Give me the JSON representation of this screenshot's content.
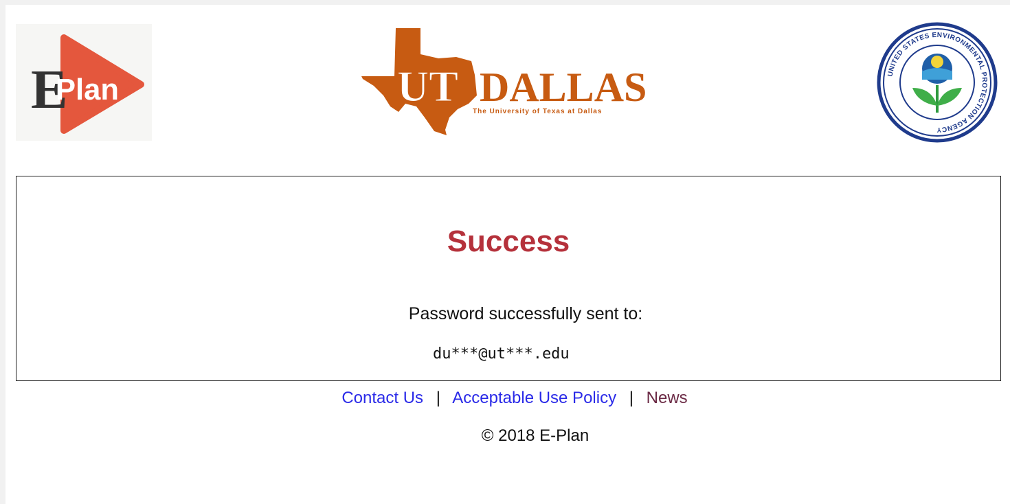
{
  "header": {
    "eplan_logo": {
      "icon": "eplan-logo-icon",
      "text_e": "E",
      "text_plan": "Plan",
      "accent_color": "#e4573d"
    },
    "utd_logo": {
      "icon": "ut-dallas-logo-icon",
      "text_ut": "UT",
      "text_dallas": "DALLAS",
      "subtitle": "The University of Texas at Dallas",
      "color": "#c75b12"
    },
    "epa_logo": {
      "icon": "epa-seal-icon",
      "ring_text": "UNITED STATES ENVIRONMENTAL PROTECTION AGENCY",
      "color": "#1f3b8c"
    }
  },
  "main": {
    "title": "Success",
    "title_color": "#b5313b",
    "message": "Password successfully sent to:",
    "email": "du***@ut***.edu"
  },
  "footer": {
    "links": [
      {
        "label": "Contact Us",
        "color": "#2a2ae8"
      },
      {
        "label": "Acceptable Use Policy",
        "color": "#2a2ae8"
      },
      {
        "label": "News",
        "color": "#6b2a45"
      }
    ],
    "separator": "|",
    "copyright": "© 2018 E-Plan"
  }
}
